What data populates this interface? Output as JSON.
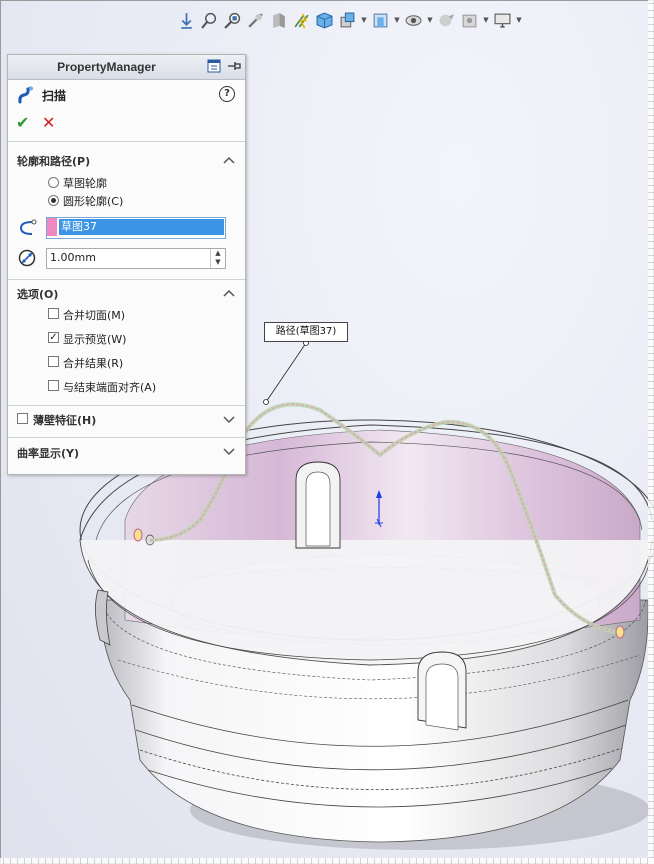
{
  "toolbar": {
    "icons": [
      "view-orientation-icon",
      "zoom-to-fit-icon",
      "zoom-area-icon",
      "previous-view-icon",
      "section-view-icon",
      "dynamic-annotation-icon",
      "view-orientation-cube-icon",
      "display-style-icon",
      "hide-show-items-icon",
      "edit-appearance-icon",
      "apply-scene-icon",
      "view-settings-icon",
      "display-monitor-icon"
    ]
  },
  "property_manager": {
    "title": "PropertyManager",
    "feature_name": "扫描",
    "help": "?",
    "ok": "✔",
    "cancel": "✕",
    "profile_path": {
      "title": "轮廓和路径(P)",
      "options": [
        {
          "label": "草图轮廓",
          "selected": false
        },
        {
          "label": "圆形轮廓(C)",
          "selected": true
        }
      ],
      "path_selection": "草图37",
      "diameter": "1.00mm"
    },
    "options": {
      "title": "选项(O)",
      "items": [
        {
          "label": "合并切面(M)",
          "checked": false
        },
        {
          "label": "显示预览(W)",
          "checked": true
        },
        {
          "label": "合并结果(R)",
          "checked": false
        },
        {
          "label": "与结束端面对齐(A)",
          "checked": false
        }
      ]
    },
    "thin_feature": {
      "title": "薄壁特征(H)",
      "checked": false
    },
    "curvature_display": {
      "title": "曲率显示(Y)"
    }
  },
  "callout": {
    "text": "路径(草图37)"
  },
  "colors": {
    "accent_selection": "#3d94e6",
    "profile_swatch": "#ef88c2",
    "arrow": "#e02020",
    "path_preview": "#e6a0c8"
  }
}
